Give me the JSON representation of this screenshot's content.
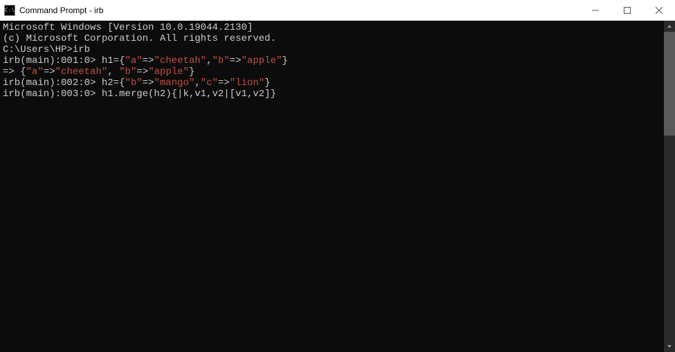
{
  "titlebar": {
    "icon_label": "C:\\",
    "title": "Command Prompt - irb"
  },
  "terminal": {
    "lines": [
      {
        "segments": [
          {
            "t": "Microsoft Windows [Version 10.0.19044.2130]",
            "c": "plain"
          }
        ]
      },
      {
        "segments": [
          {
            "t": "(c) Microsoft Corporation. All rights reserved.",
            "c": "plain"
          }
        ]
      },
      {
        "segments": [
          {
            "t": "",
            "c": "plain"
          }
        ]
      },
      {
        "segments": [
          {
            "t": "C:\\Users\\HP>irb",
            "c": "plain"
          }
        ]
      },
      {
        "segments": [
          {
            "t": "irb(main):001:0> h1={",
            "c": "plain"
          },
          {
            "t": "\"a\"",
            "c": "str"
          },
          {
            "t": "=>",
            "c": "plain"
          },
          {
            "t": "\"cheetah\"",
            "c": "str"
          },
          {
            "t": ",",
            "c": "plain"
          },
          {
            "t": "\"b\"",
            "c": "str"
          },
          {
            "t": "=>",
            "c": "plain"
          },
          {
            "t": "\"apple\"",
            "c": "str"
          },
          {
            "t": "}",
            "c": "plain"
          }
        ]
      },
      {
        "segments": [
          {
            "t": "=> {",
            "c": "plain"
          },
          {
            "t": "\"a\"",
            "c": "str"
          },
          {
            "t": "=>",
            "c": "plain"
          },
          {
            "t": "\"cheetah\"",
            "c": "str"
          },
          {
            "t": ", ",
            "c": "plain"
          },
          {
            "t": "\"b\"",
            "c": "str"
          },
          {
            "t": "=>",
            "c": "plain"
          },
          {
            "t": "\"apple\"",
            "c": "str"
          },
          {
            "t": "}",
            "c": "plain"
          }
        ]
      },
      {
        "segments": [
          {
            "t": "irb(main):002:0> h2={",
            "c": "plain"
          },
          {
            "t": "\"b\"",
            "c": "str"
          },
          {
            "t": "=>",
            "c": "plain"
          },
          {
            "t": "\"mango\"",
            "c": "str"
          },
          {
            "t": ",",
            "c": "plain"
          },
          {
            "t": "\"c\"",
            "c": "str"
          },
          {
            "t": "=>",
            "c": "plain"
          },
          {
            "t": "\"lion\"",
            "c": "str"
          },
          {
            "t": "}",
            "c": "plain"
          }
        ]
      },
      {
        "segments": [
          {
            "t": "irb(main):003:0> h1.merge(h2){|k,v1,v2|[v1,v2]}",
            "c": "plain"
          }
        ]
      }
    ]
  }
}
